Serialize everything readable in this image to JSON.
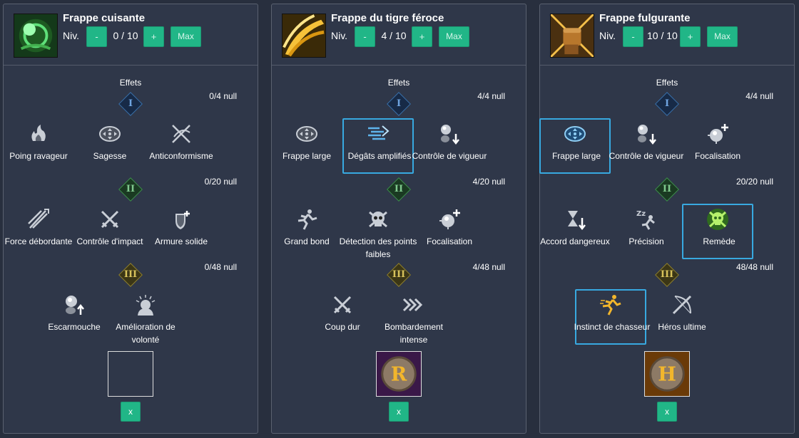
{
  "common": {
    "niv_label": "Niv.",
    "minus_label": "-",
    "plus_label": "+",
    "max_label": "Max",
    "effets_label": "Effets",
    "remove_label": "x",
    "tier_labels": [
      "I",
      "II",
      "III"
    ]
  },
  "panels": [
    {
      "title": "Frappe cuisante",
      "level": "0 / 10",
      "icon": "green-skull-swirl-icon",
      "counts": [
        "0/4 null",
        "0/20 null",
        "0/48 null"
      ],
      "tier1": [
        {
          "label": "Poing ravageur",
          "icon": "flaming-fist-icon",
          "selected": false
        },
        {
          "label": "Sagesse",
          "icon": "compass-arrows-icon",
          "selected": false
        },
        {
          "label": "Anticonformisme",
          "icon": "crossed-swirl-icon",
          "selected": false
        }
      ],
      "tier2": [
        {
          "label": "Force débordante",
          "icon": "streak-slash-icon",
          "selected": false
        },
        {
          "label": "Contrôle d'impact",
          "icon": "crossed-swords-icon",
          "selected": false
        },
        {
          "label": "Armure solide",
          "icon": "shield-plus-icon",
          "selected": false
        }
      ],
      "tier3": [
        {
          "label": "Escarmouche",
          "icon": "orb-up-arrow-icon",
          "selected": false
        },
        {
          "label": "Amélioration de volonté",
          "icon": "radiant-head-icon",
          "selected": false
        }
      ],
      "rune": "empty"
    },
    {
      "title": "Frappe du tigre féroce",
      "level": "4 / 10",
      "icon": "golden-claw-icon",
      "counts": [
        "4/4 null",
        "4/20 null",
        "4/48 null"
      ],
      "tier1": [
        {
          "label": "Frappe large",
          "icon": "compass-arrows-icon",
          "selected": false
        },
        {
          "label": "Dégâts amplifiés",
          "icon": "speed-lines-icon",
          "selected": true
        },
        {
          "label": "Contrôle de vigueur",
          "icon": "orbs-down-arrow-icon",
          "selected": false
        }
      ],
      "tier2": [
        {
          "label": "Grand bond",
          "icon": "running-man-icon",
          "selected": false
        },
        {
          "label": "Détection des points faibles",
          "icon": "skull-icon",
          "selected": false
        },
        {
          "label": "Focalisation",
          "icon": "orb-plus-icon",
          "selected": false
        }
      ],
      "tier3": [
        {
          "label": "Coup dur",
          "icon": "crossed-swords-icon",
          "selected": false
        },
        {
          "label": "Bombardement intense",
          "icon": "chevron-arrows-icon",
          "selected": false
        }
      ],
      "rune": "R"
    },
    {
      "title": "Frappe fulgurante",
      "level": "10 / 10",
      "icon": "glowing-fist-icon",
      "counts": [
        "4/4 null",
        "20/20 null",
        "48/48 null"
      ],
      "tier1": [
        {
          "label": "Frappe large",
          "icon": "compass-arrows-icon",
          "selected": true
        },
        {
          "label": "Contrôle de vigueur",
          "icon": "orbs-down-arrow-icon",
          "selected": false
        },
        {
          "label": "Focalisation",
          "icon": "orb-plus-icon",
          "selected": false
        }
      ],
      "tier2": [
        {
          "label": "Accord dangereux",
          "icon": "hourglass-down-icon",
          "selected": false
        },
        {
          "label": "Précision",
          "icon": "sleep-runner-icon",
          "selected": false
        },
        {
          "label": "Remède",
          "icon": "green-skull-icon",
          "selected": true
        }
      ],
      "tier3": [
        {
          "label": "Instinct de chasseur",
          "icon": "golden-runner-icon",
          "selected": true
        },
        {
          "label": "Héros ultime",
          "icon": "crossed-sword-bow-icon",
          "selected": false
        }
      ],
      "rune": "H"
    }
  ]
}
